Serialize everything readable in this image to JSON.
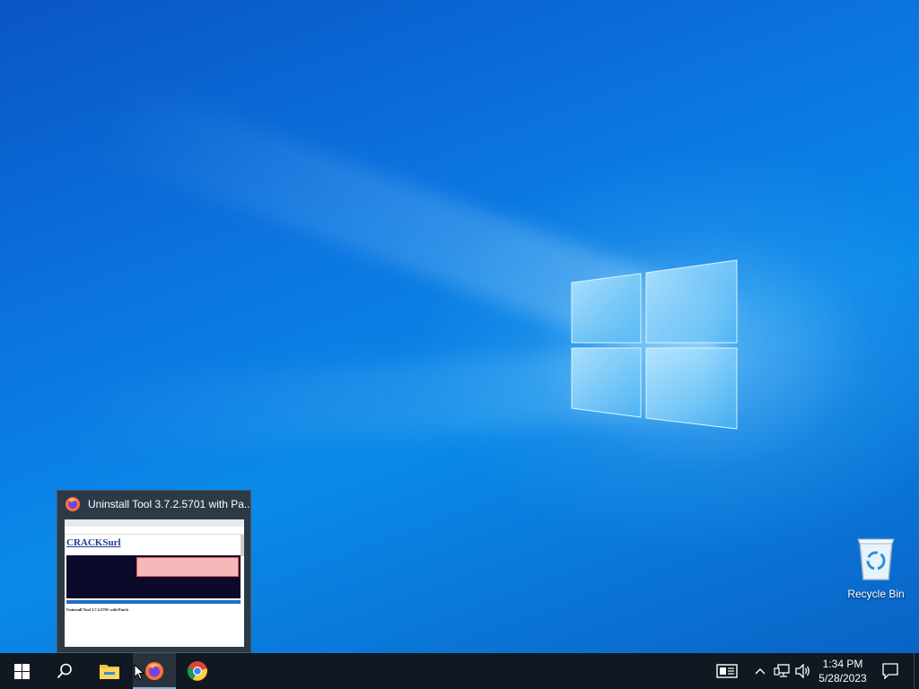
{
  "desktop": {
    "icons": [
      {
        "label": "Recycle Bin",
        "icon": "recycle-bin-icon"
      }
    ]
  },
  "thumbnail_preview": {
    "title": "Uninstall Tool 3.7.2.5701 with Pa...",
    "app_icon": "firefox-icon",
    "page": {
      "site_name": "CRACKSurl",
      "heading": "Uninstall Tool 3.7.2.5701 with Patch"
    }
  },
  "taskbar": {
    "start": {
      "icon": "windows-start-icon"
    },
    "search": {
      "icon": "search-icon"
    },
    "pinned": [
      {
        "name": "File Explorer",
        "icon": "folder-icon",
        "active": false
      },
      {
        "name": "Firefox",
        "icon": "firefox-icon",
        "active": true
      },
      {
        "name": "Google Chrome",
        "icon": "chrome-icon",
        "active": false
      }
    ],
    "tray": {
      "time": "1:34 PM",
      "date": "5/28/2023",
      "icons": [
        "news-icon",
        "chevron-up-icon",
        "network-icon",
        "volume-icon",
        "notification-icon"
      ]
    }
  },
  "colors": {
    "taskbar_bg": "#101821",
    "active_indicator": "#76b9ed",
    "desktop_blue": "#0b74e0"
  }
}
